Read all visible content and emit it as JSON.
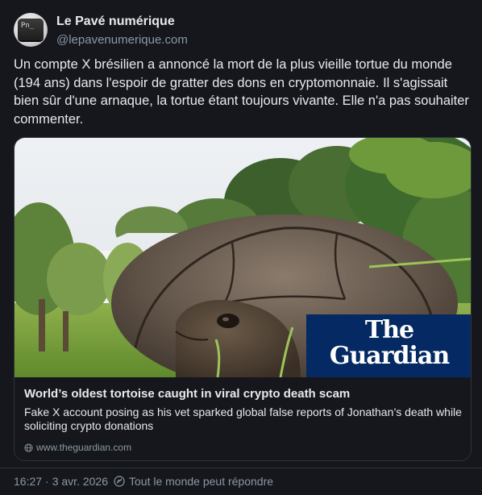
{
  "author": {
    "name": "Le Pavé numérique",
    "handle": "@lepavenumerique.com",
    "avatar_glyph": "Pn_"
  },
  "post": {
    "text": "Un compte X brésilien a annoncé la mort de la plus vieille tortue du monde (194 ans) dans l'espoir de gratter des dons en cryptomonnaie. Il s'agissait bien sûr d'une arnaque, la tortue étant toujours vivante. Elle n'a pas souhaiter commenter."
  },
  "card": {
    "logo_line1": "The",
    "logo_line2": "Guardian",
    "title": "World’s oldest tortoise caught in viral crypto death scam",
    "description": "Fake X account posing as his vet sparked global false reports of Jonathan’s death while soliciting crypto donations",
    "domain": "www.theguardian.com",
    "logo_color": "#052962"
  },
  "footer": {
    "time": "16:27",
    "separator": "·",
    "date": "3 avr. 2026",
    "reply_setting": "Tout le monde peut répondre"
  },
  "icons": {
    "domain": "globe-icon",
    "reply": "reply-settings-icon"
  }
}
